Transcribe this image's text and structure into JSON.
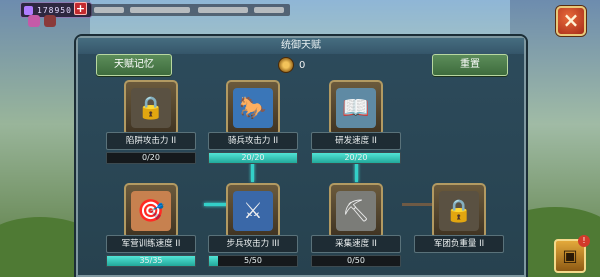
{
  "status": {
    "value": "178950",
    "plus": "+"
  },
  "close": {
    "label": "×"
  },
  "panel": {
    "title": "统御天赋",
    "memory_button": "天赋记忆",
    "reset_button": "重置",
    "points": "0"
  },
  "talents": [
    {
      "name": "陷阱攻击力 II",
      "progress": "0/20",
      "current": 0,
      "max": 20,
      "icon": "lock-icon",
      "locked": true
    },
    {
      "name": "骑兵攻击力 II",
      "progress": "20/20",
      "current": 20,
      "max": 20,
      "icon": "cavalry-icon",
      "locked": false
    },
    {
      "name": "研发速度 II",
      "progress": "20/20",
      "current": 20,
      "max": 20,
      "icon": "book-icon",
      "locked": false
    },
    {
      "name": "军营训练速度 II",
      "progress": "35/35",
      "current": 35,
      "max": 35,
      "icon": "target-icon",
      "locked": false
    },
    {
      "name": "步兵攻击力 III",
      "progress": "5/50",
      "current": 5,
      "max": 50,
      "icon": "infantry-icon",
      "locked": false
    },
    {
      "name": "采集速度 II",
      "progress": "0/50",
      "current": 0,
      "max": 50,
      "icon": "gather-icon",
      "locked": false
    },
    {
      "name": "军团负重量 II",
      "progress": "",
      "current": 0,
      "max": 0,
      "icon": "lock-icon",
      "locked": true
    }
  ],
  "colors": {
    "progress_fill": "#33d0c8",
    "panel_bg": "#2d4b5c",
    "button_green": "#4e7d4c"
  }
}
